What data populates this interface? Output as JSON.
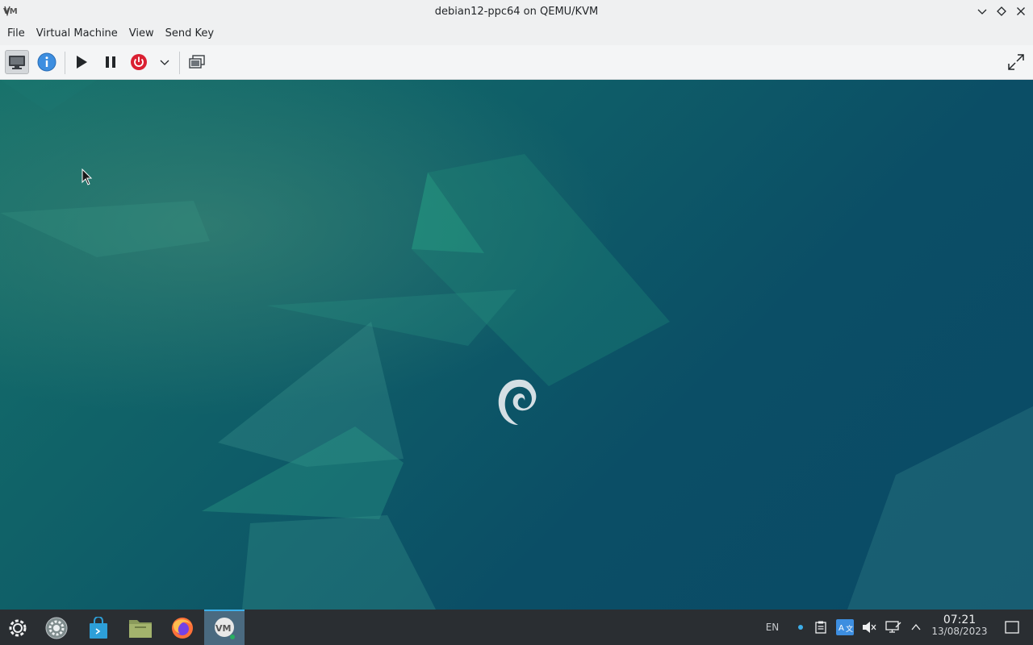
{
  "window": {
    "title": "debian12-ppc64 on QEMU/KVM",
    "app_icon": "virt-manager-icon"
  },
  "menubar": {
    "items": [
      "File",
      "Virtual Machine",
      "View",
      "Send Key"
    ]
  },
  "toolbar": {
    "buttons": [
      "console-view",
      "details-info",
      "run",
      "pause",
      "shutdown",
      "shutdown-menu",
      "snapshots",
      "fullscreen"
    ]
  },
  "taskbar": {
    "launchers": [
      "application-launcher",
      "system-settings",
      "discover-store",
      "file-manager",
      "firefox",
      "virt-manager"
    ],
    "tray": {
      "language": "EN",
      "icons": [
        "notification-dot",
        "clipboard",
        "translator",
        "volume-muted",
        "network",
        "expand-tray"
      ]
    },
    "clock": {
      "time": "07:21",
      "date": "13/08/2023"
    }
  },
  "colors": {
    "accent": "#3daee9",
    "power_red": "#da2032",
    "info_blue": "#3d8ee0",
    "taskbar": "#2a2e32"
  }
}
